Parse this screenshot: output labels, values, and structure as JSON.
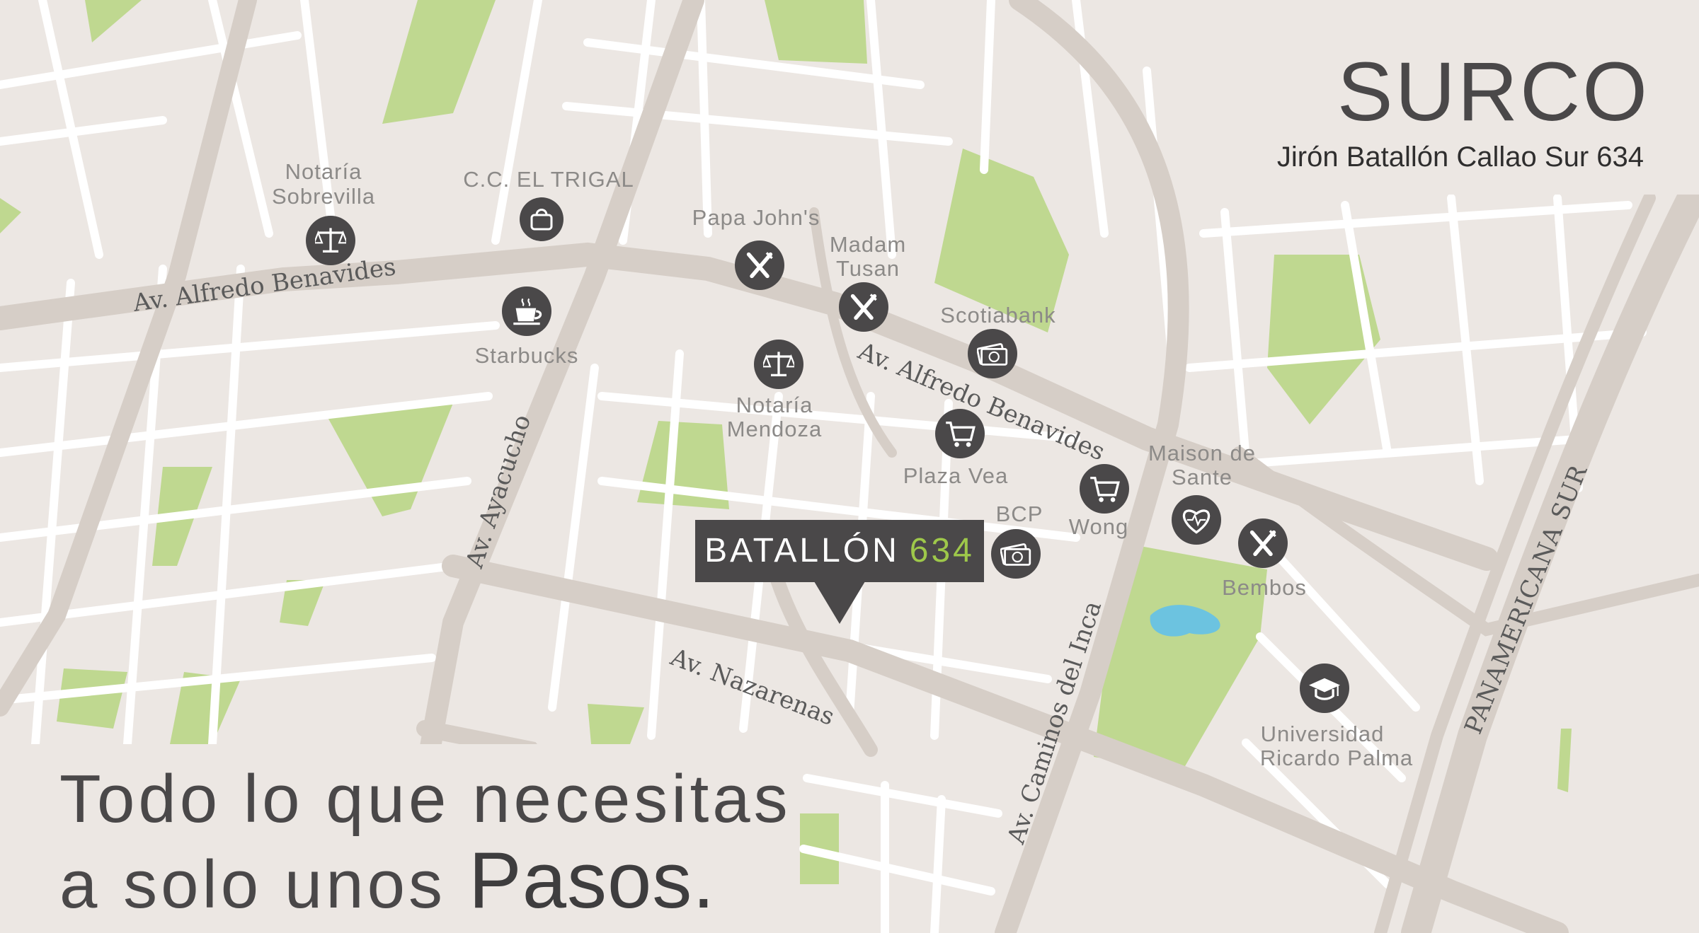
{
  "header": {
    "city": "SURCO",
    "address": "Jirón Batallón Callao Sur 634"
  },
  "tagline": {
    "line1": "Todo lo que necesitas",
    "line2": "a solo unos",
    "line2_strong": "Pasos."
  },
  "project_marker": {
    "name": "BATALLÓN",
    "number": "634"
  },
  "streets": {
    "benavides_west": "Av. Alfredo Benavides",
    "benavides_east": "Av. Alfredo Benavides",
    "ayacucho": "Av. Ayacucho",
    "nazarenas": "Av. Nazarenas",
    "caminos_del_inca": "Av. Caminos del Inca",
    "panamericana": "PANAMERICANA SUR"
  },
  "pois": {
    "notaria_sobrevilla": {
      "line1": "Notaría",
      "line2": "Sobrevilla",
      "icon": "scales-icon"
    },
    "cc_el_trigal": {
      "line1": "C.C. EL TRIGAL",
      "icon": "shopping-bag-icon"
    },
    "starbucks": {
      "line1": "Starbucks",
      "icon": "coffee-cup-icon"
    },
    "papa_johns": {
      "line1": "Papa John's",
      "icon": "fork-knife-icon"
    },
    "madam_tusan": {
      "line1": "Madam",
      "line2": "Tusan",
      "icon": "fork-knife-icon"
    },
    "notaria_mendoza": {
      "line1": "Notaría",
      "line2": "Mendoza",
      "icon": "scales-icon"
    },
    "scotiabank": {
      "line1": "Scotiabank",
      "icon": "money-icon"
    },
    "plaza_vea": {
      "line1": "Plaza Vea",
      "icon": "shopping-cart-icon"
    },
    "bcp": {
      "line1": "BCP",
      "icon": "money-icon"
    },
    "wong": {
      "line1": "Wong",
      "icon": "shopping-cart-icon"
    },
    "maison_de_sante": {
      "line1": "Maison de",
      "line2": "Sante",
      "icon": "heart-pulse-icon"
    },
    "bembos": {
      "line1": "Bembos",
      "icon": "fork-knife-icon"
    },
    "universidad_ricardo_palma": {
      "line1": "Universidad",
      "line2": "Ricardo Palma",
      "icon": "graduation-cap-icon"
    }
  },
  "colors": {
    "land": "#ece7e3",
    "road": "#d6cec7",
    "minor_road": "#ffffff",
    "park": "#bfd890",
    "water": "#6cc3e0",
    "icon_bg": "#4a4849",
    "accent": "#9ec84a"
  }
}
